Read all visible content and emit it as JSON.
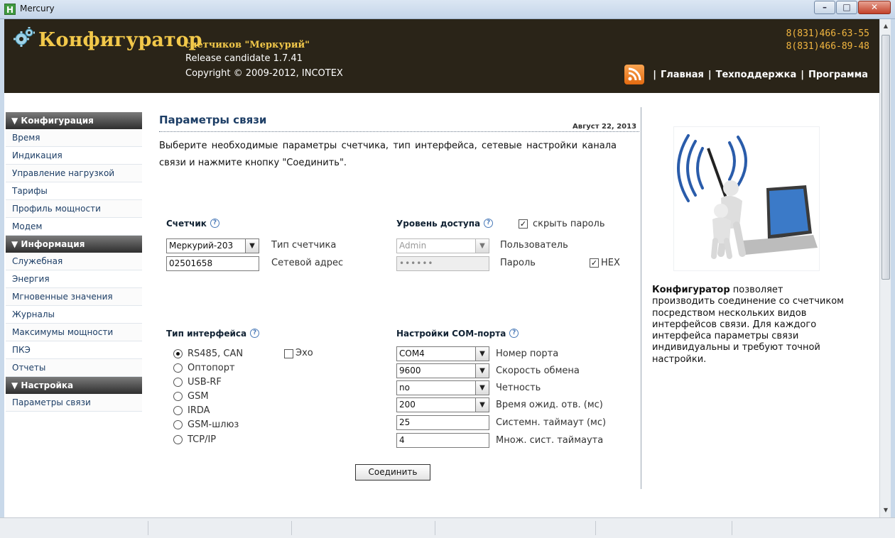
{
  "window": {
    "title": "Mercury",
    "app_icon": "H",
    "buttons": [
      "minimize-icon",
      "maximize-icon",
      "close-icon"
    ]
  },
  "header": {
    "brand": "Конфигуратор",
    "subtitle": "счетчиков \"Меркурий\"",
    "release": "Release candidate 1.7.41",
    "copyright": "Copyright © 2009-2012, INCOTEX",
    "phones": [
      "8(831)466-63-55",
      "8(831)466-89-48"
    ],
    "nav": {
      "sep": "|",
      "home": "Главная",
      "support": "Техподдержка",
      "program": "Программа"
    },
    "colors": {
      "background": "#2a2418",
      "brand": "#f2c84a",
      "phones": "#f2b640"
    }
  },
  "sidebar": {
    "sections": [
      {
        "title": "▼ Конфигурация",
        "items": [
          "Время",
          "Индикация",
          "Управление нагрузкой",
          "Тарифы",
          "Профиль мощности",
          "Модем"
        ]
      },
      {
        "title": "▼ Информация",
        "items": [
          "Служебная",
          "Энергия",
          "Мгновенные значения",
          "Журналы",
          "Максимумы мощности",
          "ПКЭ",
          "Отчеты"
        ]
      },
      {
        "title": "▼ Настройка",
        "items": [
          "Параметры связи"
        ]
      }
    ]
  },
  "main": {
    "title": "Параметры связи",
    "date": "Август 22, 2013",
    "intro": "Выберите необходимые параметры счетчика, тип интерфейса, сетевые настройки канала связи и нажмите кнопку \"Соединить\".",
    "meter": {
      "title": "Счетчик",
      "type_value": "Меркурий-203",
      "type_label": "Тип счетчика",
      "address_value": "02501658",
      "address_label": "Сетевой адрес"
    },
    "access": {
      "title": "Уровень доступа",
      "hide_password_label": "скрыть пароль",
      "hide_password_checked": "✓",
      "user_value": "Admin",
      "user_label": "Пользователь",
      "password_value": "••••••",
      "password_label": "Пароль",
      "hex_checked": "✓",
      "hex_label": "HEX"
    },
    "interface": {
      "title": "Тип интерфейса",
      "options": [
        "RS485, CAN",
        "Оптопорт",
        "USB-RF",
        "GSM",
        "IRDA",
        "GSM-шлюз",
        "TCP/IP"
      ],
      "selected": "RS485, CAN",
      "echo_label": "Эхо"
    },
    "com": {
      "title": "Настройки COM-порта",
      "port_value": "COM4",
      "port_label": "Номер порта",
      "speed_value": "9600",
      "speed_label": "Скорость обмена",
      "parity_value": "no",
      "parity_label": "Четность",
      "wait_value": "200",
      "wait_label": "Время ожид. отв. (мс)",
      "sys_timeout_value": "25",
      "sys_timeout_label": "Системн. таймаут (мс)",
      "mult_value": "4",
      "mult_label": "Множ. сист. таймаута"
    },
    "connect_label": "Соединить"
  },
  "info": {
    "bold": "Конфигуратор",
    "text": " позволяет производить соединение со счетчиком посредством нескольких видов интерфейсов связи. Для каждого интерфейса параметры связи индивидуальны и требуют точной настройки."
  }
}
